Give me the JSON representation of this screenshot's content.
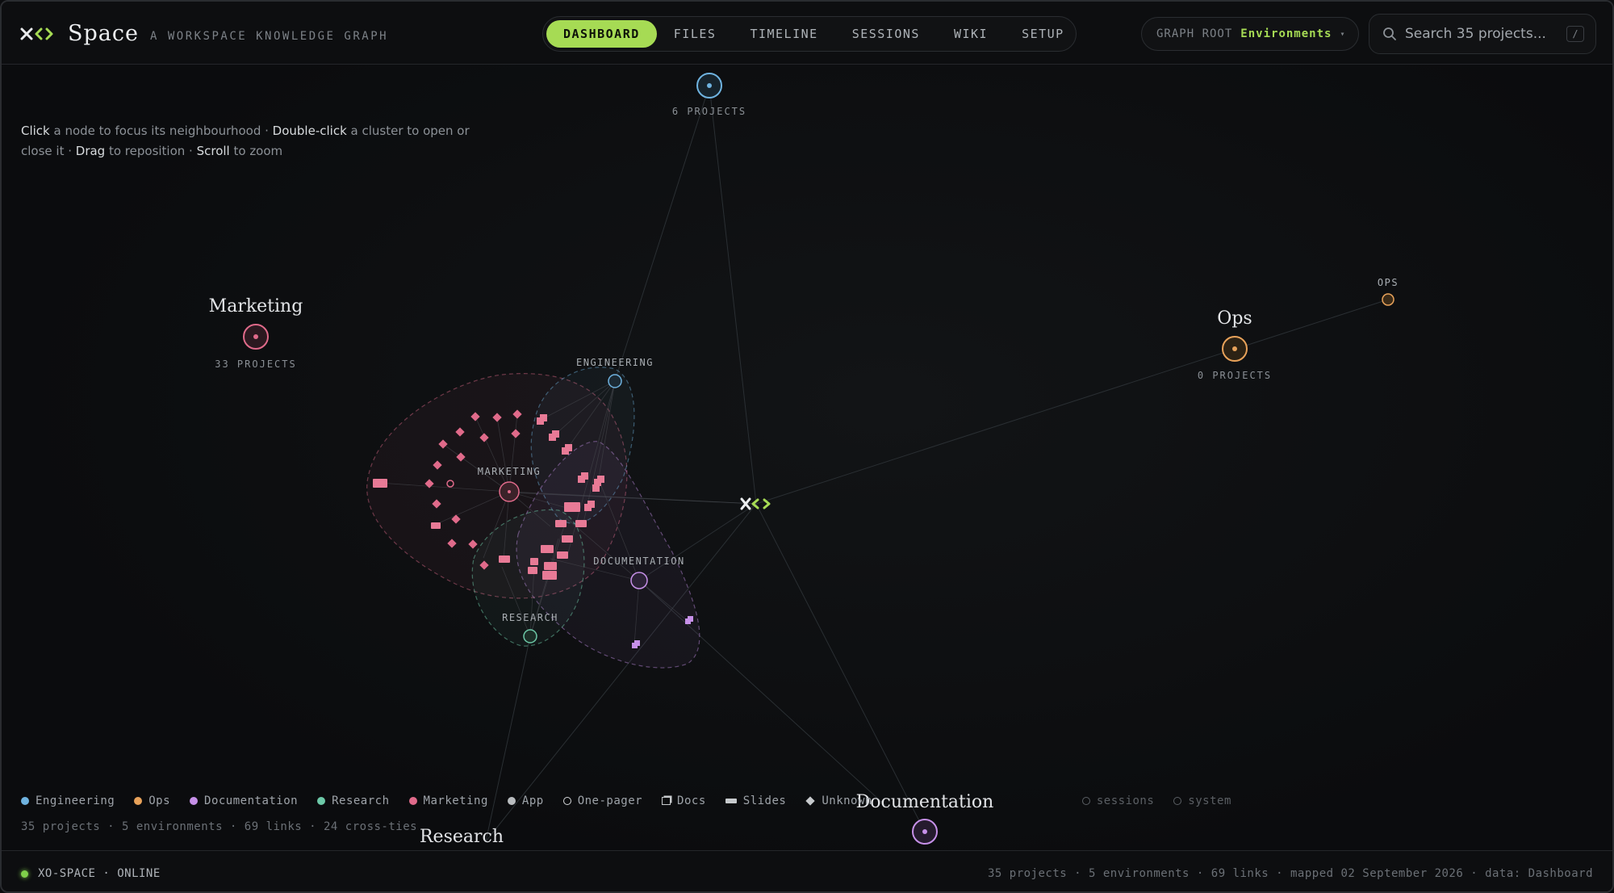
{
  "header": {
    "app_name": "Space",
    "tagline": "A WORKSPACE KNOWLEDGE GRAPH",
    "nav": [
      {
        "label": "DASHBOARD",
        "active": true
      },
      {
        "label": "FILES",
        "active": false
      },
      {
        "label": "TIMELINE",
        "active": false
      },
      {
        "label": "SESSIONS",
        "active": false
      },
      {
        "label": "WIKI",
        "active": false
      },
      {
        "label": "SETUP",
        "active": false
      }
    ],
    "graph_root": {
      "label": "GRAPH ROOT",
      "value": "Environments"
    },
    "search": {
      "placeholder": "Search 35 projects...",
      "shortcut": "/"
    }
  },
  "hint": {
    "click": "Click",
    "t1": " a node to focus its neighbourhood · ",
    "dblclick": "Double-click",
    "t2": " a cluster to open or close it · ",
    "drag": "Drag",
    "t3": " to reposition · ",
    "scroll": "Scroll",
    "t4": " to zoom"
  },
  "graph": {
    "environments": [
      {
        "name": "",
        "projects": "6 PROJECTS",
        "color": "#6fb3e0"
      },
      {
        "name": "Marketing",
        "projects": "33 PROJECTS",
        "color": "#e06a8a"
      },
      {
        "name": "Ops",
        "projects": "0 PROJECTS",
        "color": "#e8a25a"
      },
      {
        "name": "Research",
        "projects": "",
        "color": "#6dc9a8"
      },
      {
        "name": "Documentation",
        "projects": "",
        "color": "#c690e8"
      }
    ],
    "cluster_labels": {
      "engineering": "ENGINEERING",
      "marketing": "MARKETING",
      "documentation": "DOCUMENTATION",
      "research": "RESEARCH",
      "ops": "OPS"
    }
  },
  "legend": [
    {
      "label": "Engineering",
      "kind": "dot",
      "color": "#6fb3e0"
    },
    {
      "label": "Ops",
      "kind": "dot",
      "color": "#e8a25a"
    },
    {
      "label": "Documentation",
      "kind": "dot",
      "color": "#c690e8"
    },
    {
      "label": "Research",
      "kind": "dot",
      "color": "#6dc9a8"
    },
    {
      "label": "Marketing",
      "kind": "dot",
      "color": "#e06a8a"
    },
    {
      "label": "App",
      "kind": "dot",
      "color": "#b9bcbf"
    },
    {
      "label": "One-pager",
      "kind": "ring"
    },
    {
      "label": "Docs",
      "kind": "docs"
    },
    {
      "label": "Slides",
      "kind": "bar"
    },
    {
      "label": "Unknown",
      "kind": "diamond"
    },
    {
      "label": "sessions",
      "kind": "ring-dim"
    },
    {
      "label": "system",
      "kind": "ring-dim"
    }
  ],
  "stats": "35 projects · 5 environments · 69 links · 24 cross-ties",
  "footer": {
    "status": "XO-SPACE · ONLINE",
    "summary": "35 projects · 5 environments · 69 links · mapped 02 September 2026 · data: Dashboard"
  }
}
